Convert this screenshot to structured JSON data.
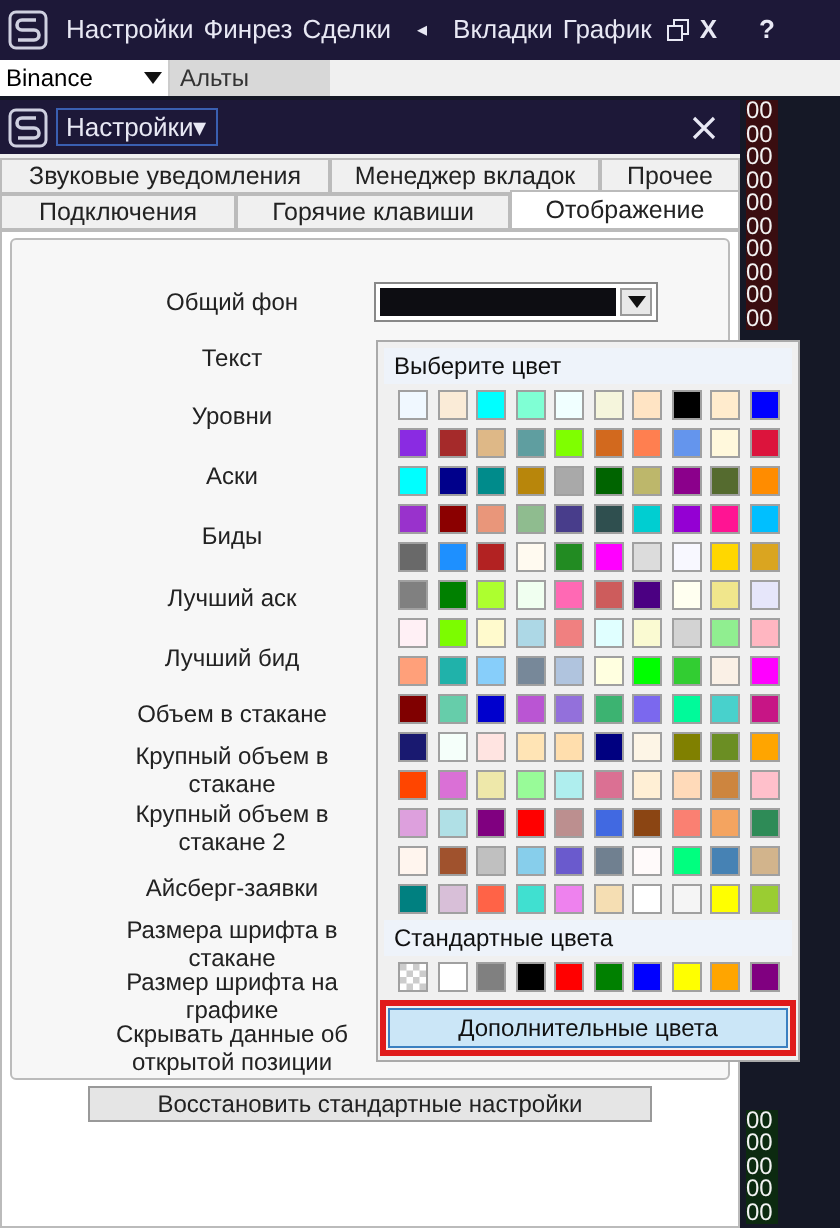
{
  "menu_bar": {
    "items": [
      {
        "kind": "text",
        "label": "Настройки"
      },
      {
        "kind": "text",
        "label": "Финрез"
      },
      {
        "kind": "text",
        "label": "Сделки"
      },
      {
        "kind": "text",
        "label": "◂"
      },
      {
        "kind": "text",
        "label": "Вкладки"
      },
      {
        "kind": "text",
        "label": "График"
      },
      {
        "kind": "restore"
      },
      {
        "kind": "bold",
        "label": "X"
      },
      {
        "kind": "help",
        "label": "?"
      }
    ]
  },
  "toolbar": {
    "exchange": "Binance",
    "tab": "Альты"
  },
  "dialog": {
    "title": "Настройки▾",
    "tab_rows": [
      [
        {
          "label": "Звуковые уведомления",
          "selected": false
        },
        {
          "label": "Менеджер вкладок",
          "selected": false
        },
        {
          "label": "Прочее",
          "selected": false
        }
      ],
      [
        {
          "label": "Подключения",
          "selected": false
        },
        {
          "label": "Горячие клавиши",
          "selected": false
        },
        {
          "label": "Отображение",
          "selected": true
        }
      ]
    ],
    "rows": [
      {
        "label": "Общий фон",
        "color": "#0d0d12"
      },
      {
        "label": "Текст"
      },
      {
        "label": "Уровни"
      },
      {
        "label": "Аски"
      },
      {
        "label": "Биды"
      },
      {
        "label": "Лучший аск"
      },
      {
        "label": "Лучший бид"
      },
      {
        "label": "Объем в стакане"
      },
      {
        "label": "Крупный объем в стакане"
      },
      {
        "label": "Крупный объем в стакане 2"
      },
      {
        "label": "Айсберг-заявки"
      },
      {
        "label": "Размера шрифта в стакане"
      },
      {
        "label": "Размер шрифта на графике"
      },
      {
        "label": "Скрывать данные об открытой позиции"
      }
    ],
    "reset_button": "Восстановить стандартные настройки"
  },
  "color_picker": {
    "title": "Выберите цвет",
    "colors": [
      {
        "color": "#f0f8ff"
      },
      {
        "color": "#faebd7"
      },
      {
        "color": "#00ffff"
      },
      {
        "color": "#7fffd4"
      },
      {
        "color": "#f0ffff"
      },
      {
        "color": "#f5f5dc"
      },
      {
        "color": "#ffe4c4"
      },
      {
        "color": "#000000"
      },
      {
        "color": "#ffebcd"
      },
      {
        "color": "#0000ff"
      },
      {
        "color": "#8a2be2"
      },
      {
        "color": "#a52a2a"
      },
      {
        "color": "#deb887"
      },
      {
        "color": "#5f9ea0"
      },
      {
        "color": "#7fff00"
      },
      {
        "color": "#d2691e"
      },
      {
        "color": "#ff7f50"
      },
      {
        "color": "#6495ed"
      },
      {
        "color": "#fff8dc"
      },
      {
        "color": "#dc143c"
      },
      {
        "color": "#00ffff"
      },
      {
        "color": "#00008b"
      },
      {
        "color": "#008b8b"
      },
      {
        "color": "#b8860b"
      },
      {
        "color": "#a9a9a9"
      },
      {
        "color": "#006400"
      },
      {
        "color": "#bdb76b"
      },
      {
        "color": "#8b008b"
      },
      {
        "color": "#556b2f"
      },
      {
        "color": "#ff8c00"
      },
      {
        "color": "#9932cc"
      },
      {
        "color": "#8b0000"
      },
      {
        "color": "#e9967a"
      },
      {
        "color": "#8fbc8f"
      },
      {
        "color": "#483d8b"
      },
      {
        "color": "#2f4f4f"
      },
      {
        "color": "#00ced1"
      },
      {
        "color": "#9400d3"
      },
      {
        "color": "#ff1493"
      },
      {
        "color": "#00bfff"
      },
      {
        "color": "#696969"
      },
      {
        "color": "#1e90ff"
      },
      {
        "color": "#b22222"
      },
      {
        "color": "#fffaf0"
      },
      {
        "color": "#228b22"
      },
      {
        "color": "#ff00ff"
      },
      {
        "color": "#dcdcdc"
      },
      {
        "color": "#f8f8ff"
      },
      {
        "color": "#ffd700"
      },
      {
        "color": "#daa520"
      },
      {
        "color": "#808080"
      },
      {
        "color": "#008000"
      },
      {
        "color": "#adff2f"
      },
      {
        "color": "#f0fff0"
      },
      {
        "color": "#ff69b4"
      },
      {
        "color": "#cd5c5c"
      },
      {
        "color": "#4b0082"
      },
      {
        "color": "#fffff0"
      },
      {
        "color": "#f0e68c"
      },
      {
        "color": "#e6e6fa"
      },
      {
        "color": "#fff0f5"
      },
      {
        "color": "#7cfc00"
      },
      {
        "color": "#fffacd"
      },
      {
        "color": "#add8e6"
      },
      {
        "color": "#f08080"
      },
      {
        "color": "#e0ffff"
      },
      {
        "color": "#fafad2"
      },
      {
        "color": "#d3d3d3"
      },
      {
        "color": "#90ee90"
      },
      {
        "color": "#ffb6c1"
      },
      {
        "color": "#ffa07a"
      },
      {
        "color": "#20b2aa"
      },
      {
        "color": "#87cefa"
      },
      {
        "color": "#778899"
      },
      {
        "color": "#b0c4de"
      },
      {
        "color": "#ffffe0"
      },
      {
        "color": "#00ff00"
      },
      {
        "color": "#32cd32"
      },
      {
        "color": "#faf0e6"
      },
      {
        "color": "#ff00ff"
      },
      {
        "color": "#800000"
      },
      {
        "color": "#66cdaa"
      },
      {
        "color": "#0000cd"
      },
      {
        "color": "#ba55d3"
      },
      {
        "color": "#9370db"
      },
      {
        "color": "#3cb371"
      },
      {
        "color": "#7b68ee"
      },
      {
        "color": "#00fa9a"
      },
      {
        "color": "#48d1cc"
      },
      {
        "color": "#c71585"
      },
      {
        "color": "#191970"
      },
      {
        "color": "#f5fffa"
      },
      {
        "color": "#ffe4e1"
      },
      {
        "color": "#ffe4b5"
      },
      {
        "color": "#ffdead"
      },
      {
        "color": "#000080"
      },
      {
        "color": "#fdf5e6"
      },
      {
        "color": "#808000"
      },
      {
        "color": "#6b8e23"
      },
      {
        "color": "#ffa500"
      },
      {
        "color": "#ff4500"
      },
      {
        "color": "#da70d6"
      },
      {
        "color": "#eee8aa"
      },
      {
        "color": "#98fb98"
      },
      {
        "color": "#afeeee"
      },
      {
        "color": "#db7093"
      },
      {
        "color": "#ffefd5"
      },
      {
        "color": "#ffdab9"
      },
      {
        "color": "#cd853f"
      },
      {
        "color": "#ffc0cb"
      },
      {
        "color": "#dda0dd"
      },
      {
        "color": "#b0e0e6"
      },
      {
        "color": "#800080"
      },
      {
        "color": "#ff0000"
      },
      {
        "color": "#bc8f8f"
      },
      {
        "color": "#4169e1"
      },
      {
        "color": "#8b4513"
      },
      {
        "color": "#fa8072"
      },
      {
        "color": "#f4a460"
      },
      {
        "color": "#2e8b57"
      },
      {
        "color": "#fff5ee"
      },
      {
        "color": "#a0522d"
      },
      {
        "color": "#c0c0c0"
      },
      {
        "color": "#87ceeb"
      },
      {
        "color": "#6a5acd"
      },
      {
        "color": "#708090"
      },
      {
        "color": "#fffafa"
      },
      {
        "color": "#00ff7f"
      },
      {
        "color": "#4682b4"
      },
      {
        "color": "#d2b48c"
      },
      {
        "color": "#008080"
      },
      {
        "color": "#d8bfd8"
      },
      {
        "color": "#ff6347"
      },
      {
        "color": "#40e0d0"
      },
      {
        "color": "#ee82ee"
      },
      {
        "color": "#f5deb3"
      },
      {
        "color": "#ffffff"
      },
      {
        "color": "#f5f5f5"
      },
      {
        "color": "#ffff00"
      },
      {
        "color": "#9acd32"
      }
    ],
    "standard_title": "Стандартные цвета",
    "standard_colors": [
      {
        "kind": "transparent"
      },
      {
        "kind": "solid",
        "color": "#ffffff"
      },
      {
        "kind": "solid",
        "color": "#808080"
      },
      {
        "kind": "solid",
        "color": "#000000"
      },
      {
        "kind": "solid",
        "color": "#ff0000"
      },
      {
        "kind": "solid",
        "color": "#008000"
      },
      {
        "kind": "solid",
        "color": "#0000ff"
      },
      {
        "kind": "solid",
        "color": "#ffff00"
      },
      {
        "kind": "solid",
        "color": "#ffa500"
      },
      {
        "kind": "solid",
        "color": "#800080"
      }
    ],
    "more_button": "Дополнительные цвета"
  },
  "order_book": {
    "top_cells": [
      "00",
      "00",
      "00",
      "00",
      "00",
      "00",
      "00",
      "00",
      "00",
      "00"
    ],
    "bottom_cells": [
      "00",
      "00",
      "00",
      "00",
      "00"
    ]
  }
}
